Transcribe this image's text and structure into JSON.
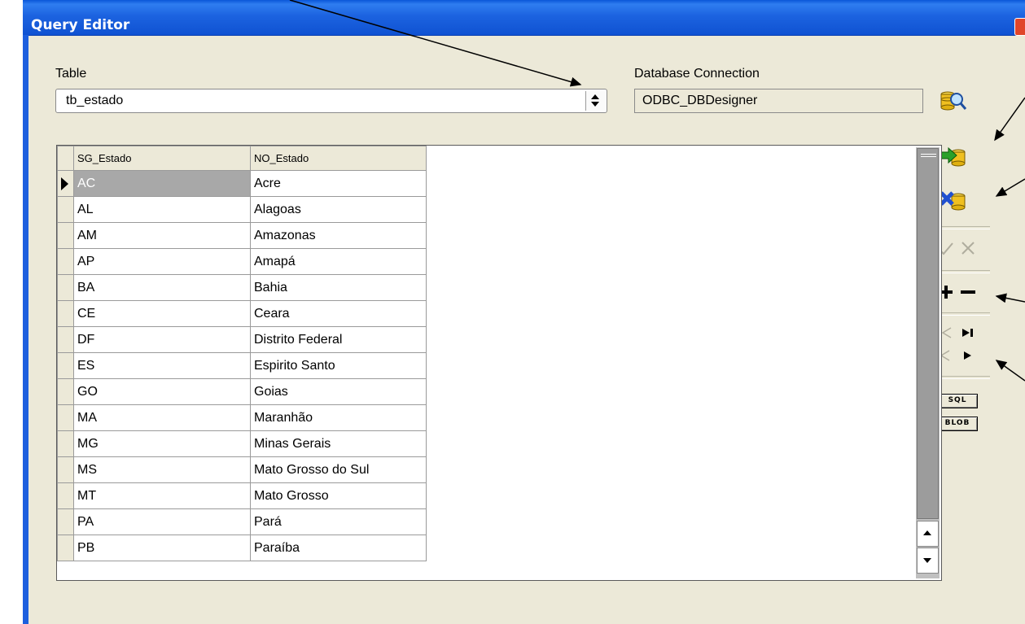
{
  "window": {
    "title": "Query Editor"
  },
  "table_field": {
    "label": "Table",
    "value": "tb_estado"
  },
  "connection_field": {
    "label": "Database Connection",
    "value": "ODBC_DBDesigner"
  },
  "grid": {
    "columns": [
      "SG_Estado",
      "NO_Estado"
    ],
    "rows": [
      [
        "AC",
        "Acre"
      ],
      [
        "AL",
        "Alagoas"
      ],
      [
        "AM",
        "Amazonas"
      ],
      [
        "AP",
        "Amapá"
      ],
      [
        "BA",
        "Bahia"
      ],
      [
        "CE",
        "Ceara"
      ],
      [
        "DF",
        "Distrito Federal"
      ],
      [
        "ES",
        "Espirito Santo"
      ],
      [
        "GO",
        "Goias"
      ],
      [
        "MA",
        "Maranhão"
      ],
      [
        "MG",
        "Minas Gerais"
      ],
      [
        "MS",
        "Mato Grosso do Sul"
      ],
      [
        "MT",
        "Mato Grosso"
      ],
      [
        "PA",
        "Pará"
      ],
      [
        "PB",
        "Paraíba"
      ]
    ]
  },
  "toolbar": {
    "sql_label": "SQL",
    "blob_label": "BLOB",
    "icons": [
      "search-database-icon",
      "commit-data-icon",
      "cancel-data-icon",
      "post-edit-icon",
      "cancel-edit-icon",
      "insert-record-icon",
      "delete-record-icon",
      "first-record-icon",
      "last-record-icon",
      "prior-record-icon",
      "next-record-icon"
    ]
  },
  "colors": {
    "titlebar": "#0a56d8",
    "window_bg": "#ece9d8",
    "selected_cell": "#a8a8a8"
  }
}
